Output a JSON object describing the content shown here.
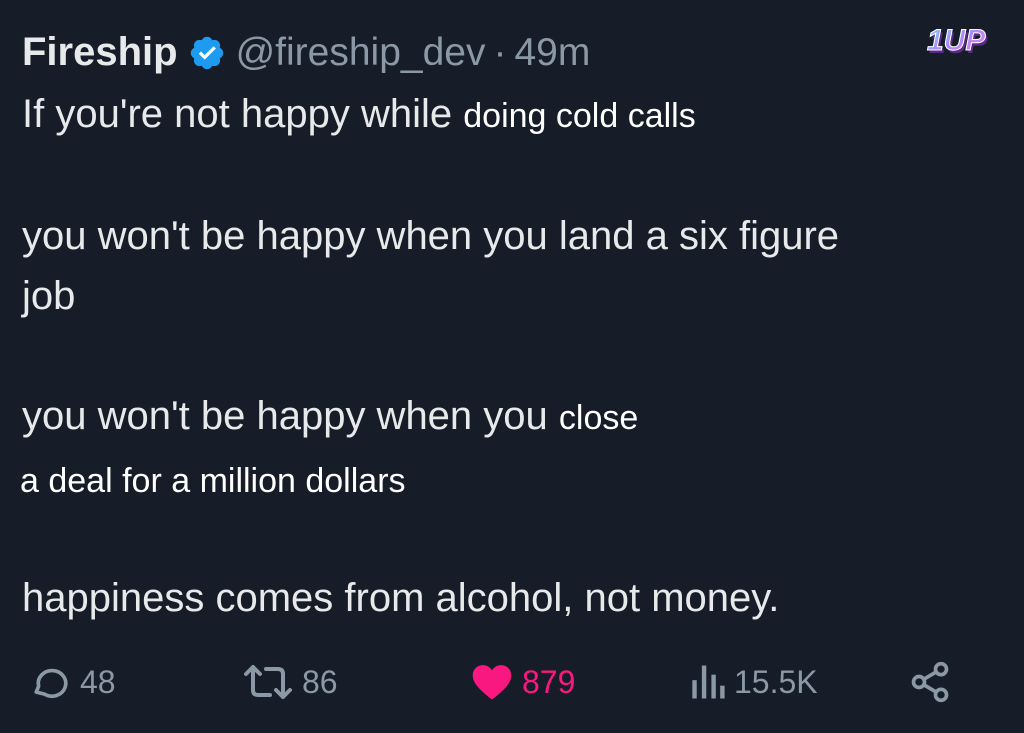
{
  "tweet": {
    "author_name": "Fireship",
    "handle": "@fireship_dev",
    "separator": "·",
    "time": "49m",
    "lines": [
      {
        "original": "If you're not happy while",
        "overlay": "doing cold calls"
      },
      {
        "original": "you won't be happy when you land a six figure"
      },
      {
        "original": "job"
      },
      {
        "original": "you won't be happy when you",
        "overlay": "close"
      },
      {
        "overlay": "a deal for a million dollars"
      },
      {
        "original": "happiness comes from alcohol, not money."
      }
    ]
  },
  "logo": {
    "text": "1UP"
  },
  "actions": {
    "replies": "48",
    "reposts": "86",
    "likes": "879",
    "views": "15.5K"
  },
  "colors": {
    "background": "#161d28",
    "text": "#e7e9ea",
    "muted": "#8b98a5",
    "verified": "#1d9bf0",
    "like": "#f91880"
  },
  "icons": [
    "verified-badge-icon",
    "reply-icon",
    "repost-icon",
    "like-icon",
    "views-icon",
    "share-icon"
  ]
}
